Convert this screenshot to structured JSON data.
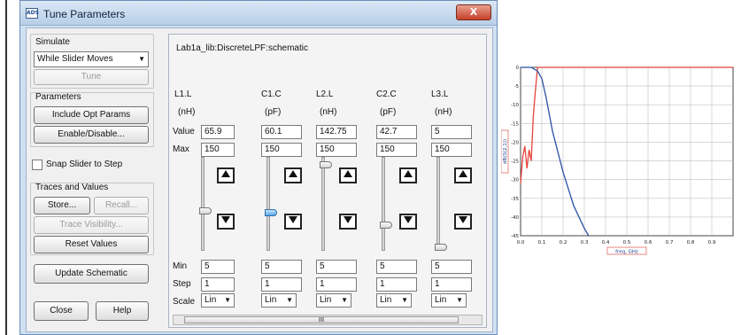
{
  "window": {
    "title": "Tune Parameters",
    "close_label": "X",
    "app_icon_label": "ADS"
  },
  "simulate": {
    "label": "Simulate",
    "mode": "While Slider Moves",
    "tune_label": "Tune"
  },
  "parameters": {
    "label": "Parameters",
    "include_opt_label": "Include Opt Params",
    "enable_disable_label": "Enable/Disable..."
  },
  "snap": {
    "label": "Snap Slider to Step",
    "checked": false
  },
  "traces": {
    "label": "Traces and Values",
    "store_label": "Store...",
    "recall_label": "Recall...",
    "visibility_label": "Trace Visibility...",
    "reset_label": "Reset Values"
  },
  "update_label": "Update Schematic",
  "close_label": "Close",
  "help_label": "Help",
  "schematic_name": "Lab1a_lib:DiscreteLPF:schematic",
  "row_labels": {
    "value": "Value",
    "max": "Max",
    "min": "Min",
    "step": "Step",
    "scale": "Scale"
  },
  "params": [
    {
      "name": "L1.L",
      "unit": "(nH)",
      "value": "65.9",
      "max": "150",
      "min": "5",
      "step": "1",
      "scale": "Lin",
      "level": 0.42
    },
    {
      "name": "C1.C",
      "unit": "(pF)",
      "value": "60.1",
      "max": "150",
      "min": "5",
      "step": "1",
      "scale": "Lin",
      "level": 0.4
    },
    {
      "name": "L2.L",
      "unit": "(nH)",
      "value": "142.75",
      "max": "150",
      "min": "5",
      "step": "1",
      "scale": "Lin",
      "level": 0.95
    },
    {
      "name": "C2.C",
      "unit": "(pF)",
      "value": "42.7",
      "max": "150",
      "min": "5",
      "step": "1",
      "scale": "Lin",
      "level": 0.26
    },
    {
      "name": "L3.L",
      "unit": "(nH)",
      "value": "5",
      "max": "150",
      "min": "5",
      "step": "1",
      "scale": "Lin",
      "level": 0.0
    }
  ],
  "scroll_grip": "III",
  "chart_data": {
    "type": "line",
    "xlabel": "freq, GHz",
    "ylabel": "dB(S(2,1))",
    "xlim": [
      0,
      1.0
    ],
    "ylim": [
      -45,
      0
    ],
    "x_ticks": [
      "0.0",
      "0.1",
      "0.2",
      "0.3",
      "0.4",
      "0.5",
      "0.6",
      "0.7",
      "0.8",
      "0.9"
    ],
    "y_ticks": [
      "0",
      "-5",
      "-10",
      "-15",
      "-20",
      "-25",
      "-30",
      "-35",
      "-40",
      "-45"
    ],
    "grid": true,
    "series": [
      {
        "color": "#e8423a",
        "x": [
          0.0,
          0.01,
          0.02,
          0.03,
          0.04,
          0.05,
          0.06,
          0.07,
          0.08,
          0.1,
          0.2,
          0.4,
          0.6,
          0.8,
          1.0
        ],
        "y": [
          -31,
          -24,
          -21,
          -27,
          -22,
          -25,
          -13,
          -6,
          0,
          0,
          0,
          0,
          0,
          0,
          0
        ]
      },
      {
        "color": "#2b4fa8",
        "x": [
          0.0,
          0.05,
          0.08,
          0.1,
          0.12,
          0.15,
          0.2,
          0.25,
          0.3,
          0.32
        ],
        "y": [
          0,
          0,
          -1,
          -3,
          -8,
          -17,
          -28,
          -37,
          -43,
          -45
        ]
      }
    ]
  }
}
